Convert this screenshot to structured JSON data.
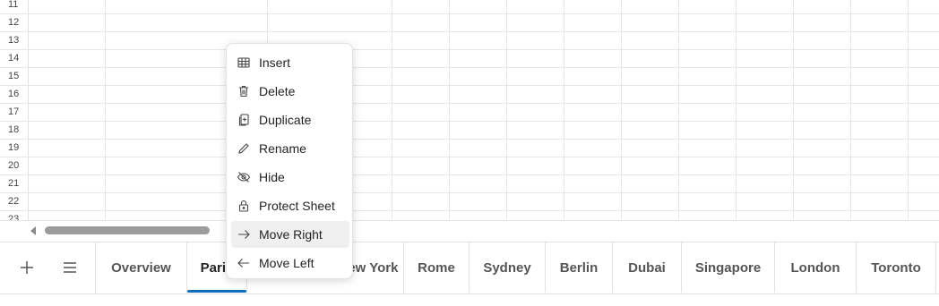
{
  "grid": {
    "rows": [
      "11",
      "12",
      "13",
      "14",
      "15",
      "16",
      "17",
      "18",
      "19",
      "20",
      "21",
      "22",
      "23"
    ]
  },
  "sheet_tabs": {
    "add_button_icon": "plus-icon",
    "list_button_icon": "menu-icon",
    "tabs": [
      {
        "label": "Overview"
      },
      {
        "label": "Paris",
        "active": true
      },
      {
        "label": "New York"
      },
      {
        "label": "Rome"
      },
      {
        "label": "Sydney"
      },
      {
        "label": "Berlin"
      },
      {
        "label": "Dubai"
      },
      {
        "label": "Singapore"
      },
      {
        "label": "London"
      },
      {
        "label": "Toronto"
      }
    ],
    "accent_color": "#0f6cbd"
  },
  "context_menu": {
    "items": [
      {
        "label": "Insert",
        "icon": "table-insert-icon"
      },
      {
        "label": "Delete",
        "icon": "trash-icon"
      },
      {
        "label": "Duplicate",
        "icon": "duplicate-icon"
      },
      {
        "label": "Rename",
        "icon": "pencil-icon"
      },
      {
        "label": "Hide",
        "icon": "eye-off-icon"
      },
      {
        "label": "Protect Sheet",
        "icon": "lock-icon"
      },
      {
        "label": "Move Right",
        "icon": "arrow-right-icon",
        "highlighted": true
      },
      {
        "label": "Move Left",
        "icon": "arrow-left-icon"
      }
    ]
  }
}
